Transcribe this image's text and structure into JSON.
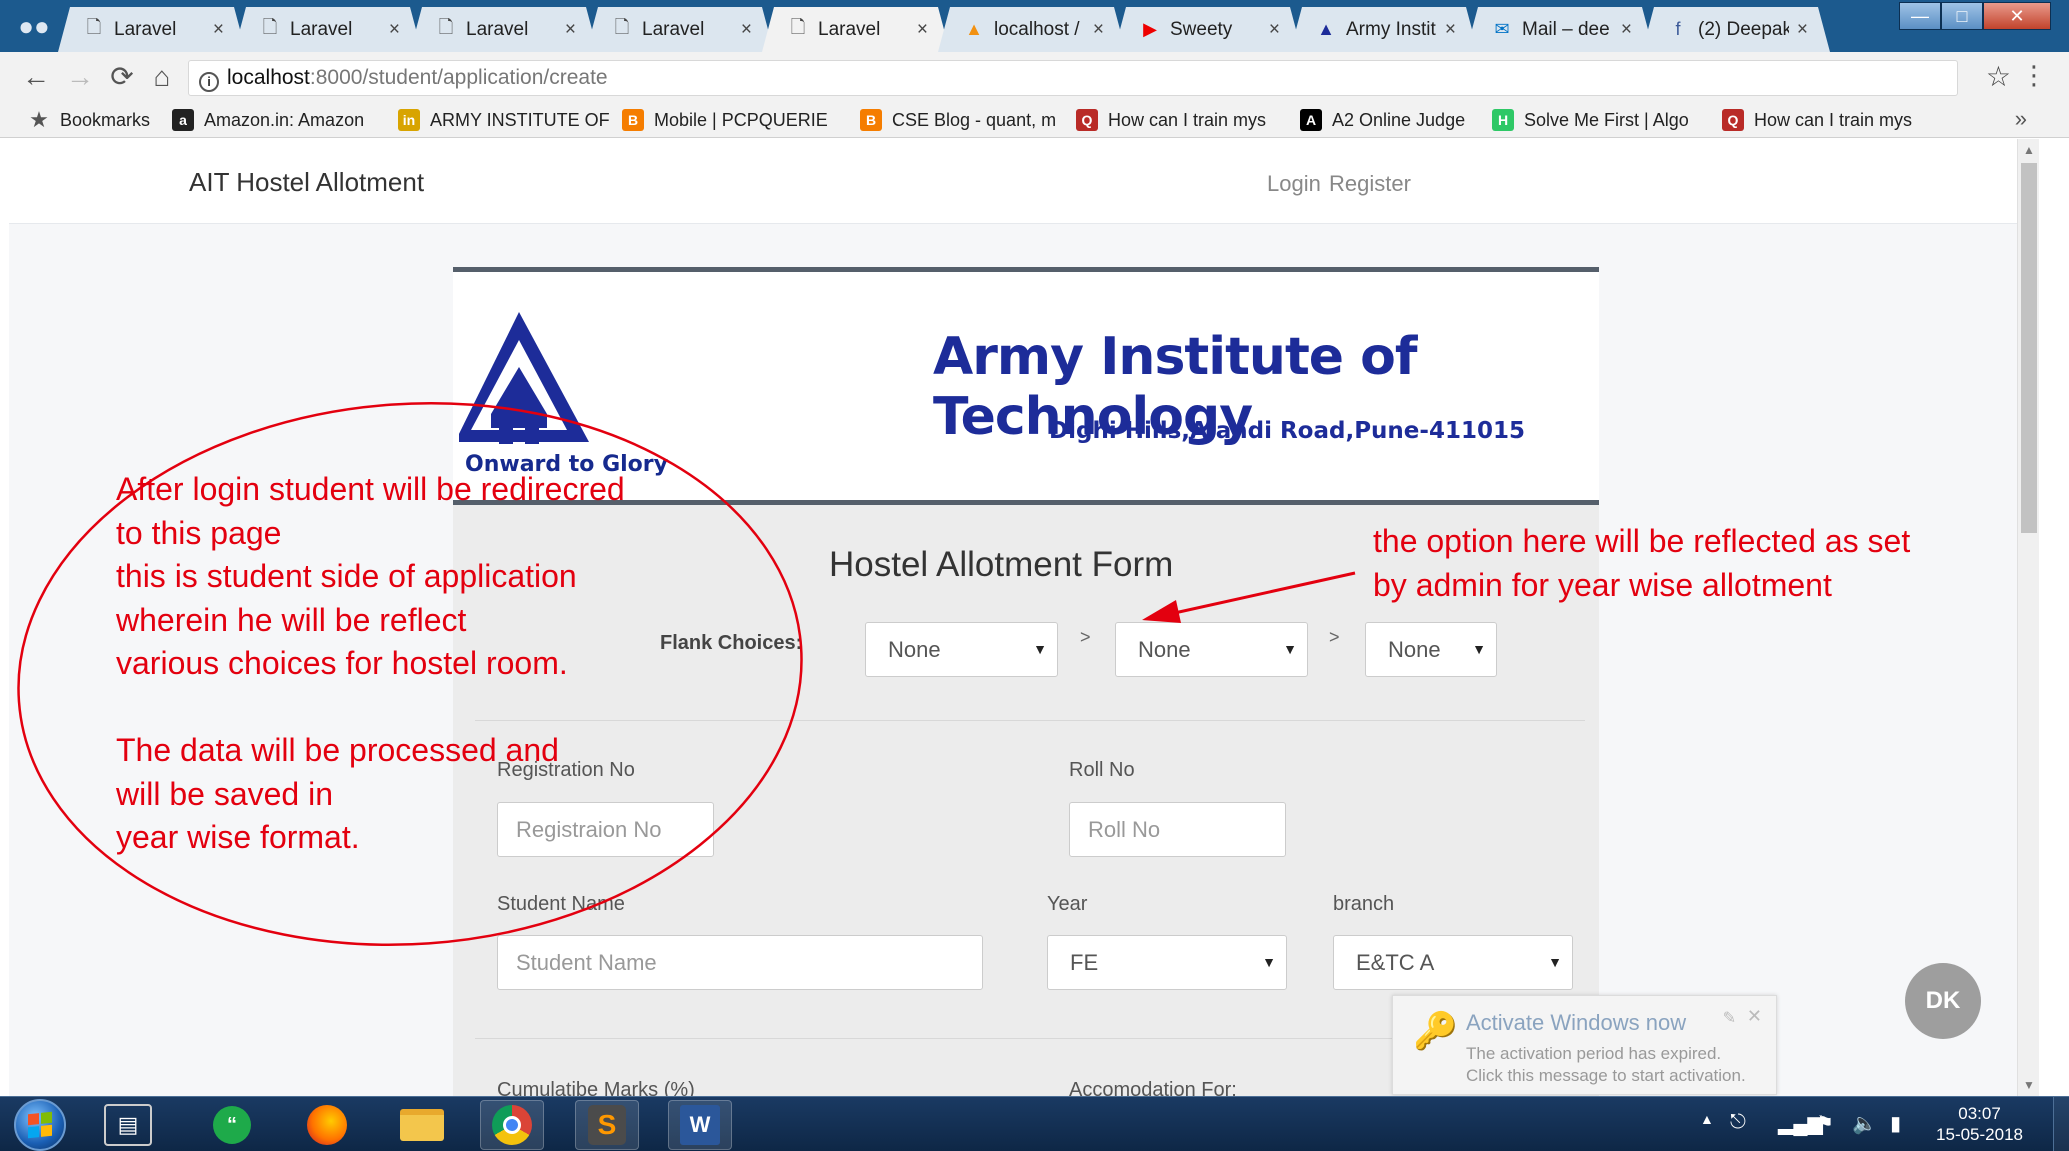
{
  "browser": {
    "tabs": [
      {
        "title": "Laravel",
        "icon": "page-icon",
        "active": false
      },
      {
        "title": "Laravel",
        "icon": "page-icon",
        "active": false
      },
      {
        "title": "Laravel",
        "icon": "page-icon",
        "active": false
      },
      {
        "title": "Laravel",
        "icon": "page-icon",
        "active": false
      },
      {
        "title": "Laravel",
        "icon": "page-icon",
        "active": true
      },
      {
        "title": "localhost /",
        "icon": "phpmyadmin-icon",
        "active": false
      },
      {
        "title": "Sweety",
        "icon": "youtube-icon",
        "active": false
      },
      {
        "title": "Army Instit",
        "icon": "army-icon",
        "active": false
      },
      {
        "title": "Mail – dee",
        "icon": "outlook-icon",
        "active": false
      },
      {
        "title": "(2) Deepak",
        "icon": "facebook-icon",
        "active": false
      }
    ],
    "close_glyph": "×",
    "url_host": "localhost",
    "url_path": ":8000/student/application/create",
    "bookmarks": [
      {
        "label": "Bookmarks",
        "icon": "star-icon"
      },
      {
        "label": "Amazon.in: Amazon",
        "icon": "a",
        "color": "#222222"
      },
      {
        "label": "ARMY INSTITUTE OF",
        "icon": "in",
        "color": "#d8a400"
      },
      {
        "label": "Mobile | PCPQUERIE",
        "icon": "B",
        "color": "#f57d00"
      },
      {
        "label": "CSE Blog - quant, m",
        "icon": "B",
        "color": "#f57d00"
      },
      {
        "label": "How can I train mys",
        "icon": "Q",
        "color": "#b92b27"
      },
      {
        "label": "A2 Online Judge",
        "icon": "A",
        "color": "#000000"
      },
      {
        "label": "Solve Me First | Algo",
        "icon": "H",
        "color": "#2ec866"
      },
      {
        "label": "How can I train mys",
        "icon": "Q",
        "color": "#b92b27"
      }
    ],
    "more_glyph": "»"
  },
  "app": {
    "brand": "AIT Hostel Allotment",
    "nav": {
      "login": "Login",
      "register": "Register"
    },
    "header": {
      "logo_motto": "Onward to Glory",
      "institute": "Army Institute of Technology",
      "address": "Dighi Hills,Alandi Road,Pune-411015"
    },
    "form": {
      "title": "Hostel Allotment Form",
      "flank_label": "Flank Choices:",
      "flank_choices": [
        "None",
        "None",
        "None"
      ],
      "separator": ">",
      "registration_label": "Registration No",
      "registration_placeholder": "Registraion No",
      "roll_label": "Roll No",
      "roll_placeholder": "Roll No",
      "name_label": "Student Name",
      "name_placeholder": "Student Name",
      "year_label": "Year",
      "year_value": "FE",
      "branch_label": "branch",
      "branch_value": "E&TC A",
      "marks_label": "Cumulatibe Marks (%)",
      "accommodation_label": "Accomodation For:"
    },
    "avatar_initials": "DK"
  },
  "activation": {
    "title": "Activate Windows now",
    "line1": "The activation period has expired.",
    "line2": "Click this message to start activation."
  },
  "annotations": {
    "left": [
      "After login student will be redirecred",
      "to this page",
      "this is student side of application",
      "wherein he will be reflect",
      "various choices for hostel room.",
      "",
      "The data will be processed and",
      "will be saved in",
      "year wise format."
    ],
    "right": [
      "the option here will be reflected as set",
      "by admin for year wise allotment"
    ],
    "color": "#e3000f"
  },
  "taskbar": {
    "clock_time": "03:07",
    "clock_date": "15-05-2018"
  }
}
